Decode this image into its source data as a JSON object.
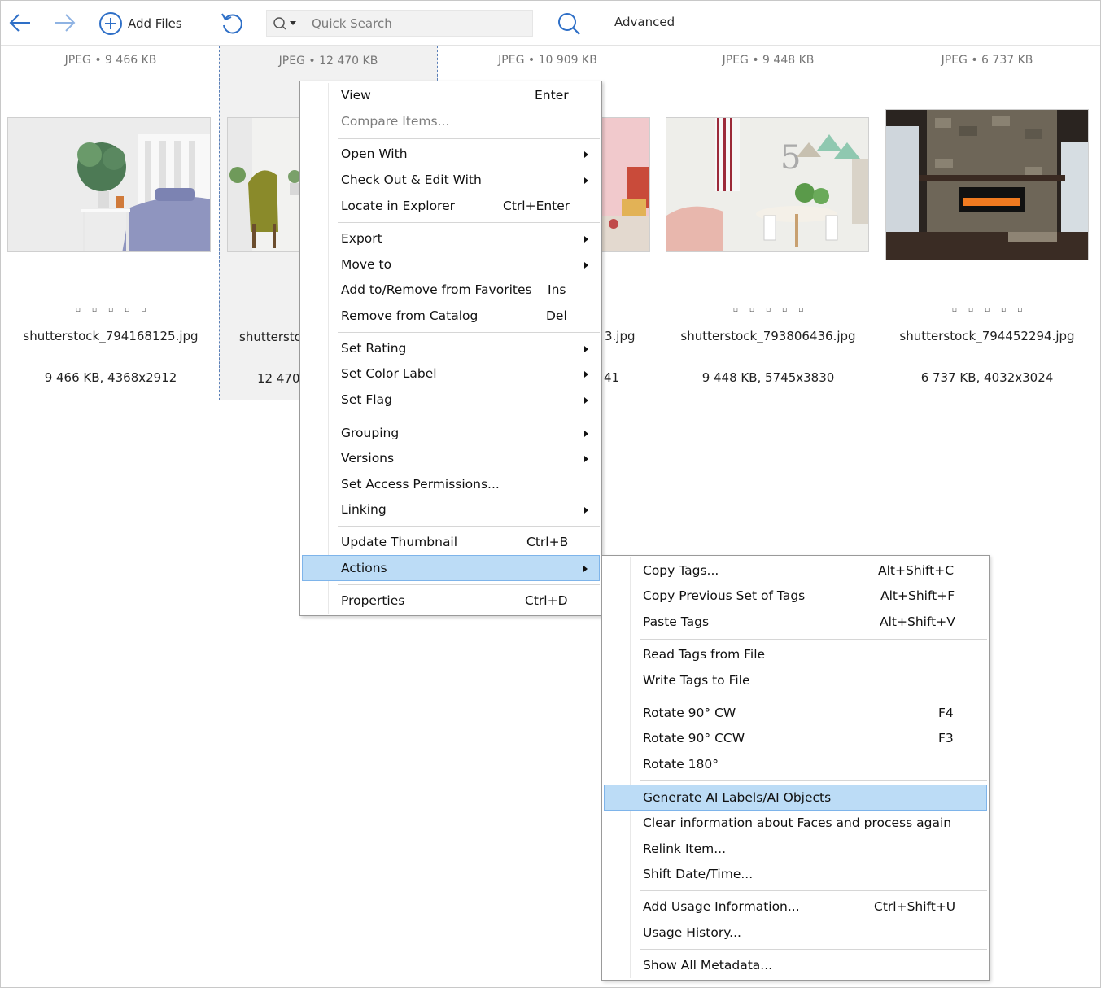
{
  "toolbar": {
    "add_files": "Add Files",
    "search_placeholder": "Quick Search",
    "advanced": "Advanced"
  },
  "tiles": [
    {
      "format": "JPEG • 9 466 KB",
      "filename": "shutterstock_794168125.jpg",
      "info": "9 466 KB, 4368x2912"
    },
    {
      "format": "JPEG • 12 470 KB",
      "filename": "shutterstock",
      "info": "12 470"
    },
    {
      "format": "JPEG • 10 909 KB",
      "filename": "3.jpg",
      "info": "41"
    },
    {
      "format": "JPEG • 9 448 KB",
      "filename": "shutterstock_793806436.jpg",
      "info": "9 448 KB, 5745x3830"
    },
    {
      "format": "JPEG • 6 737 KB",
      "filename": "shutterstock_794452294.jpg",
      "info": "6 737 KB, 4032x3024"
    }
  ],
  "context_menu": {
    "view": "View",
    "view_sc": "Enter",
    "compare": "Compare Items...",
    "open_with": "Open With",
    "checkout": "Check Out & Edit With",
    "locate": "Locate in Explorer",
    "locate_sc": "Ctrl+Enter",
    "export": "Export",
    "move_to": "Move to",
    "favorites": "Add to/Remove from Favorites",
    "favorites_sc": "Ins",
    "remove": "Remove from Catalog",
    "remove_sc": "Del",
    "set_rating": "Set Rating",
    "set_color": "Set Color Label",
    "set_flag": "Set Flag",
    "grouping": "Grouping",
    "versions": "Versions",
    "permissions": "Set Access Permissions...",
    "linking": "Linking",
    "update_thumb": "Update Thumbnail",
    "update_thumb_sc": "Ctrl+B",
    "actions": "Actions",
    "properties": "Properties",
    "properties_sc": "Ctrl+D"
  },
  "actions_menu": {
    "copy_tags": "Copy Tags...",
    "copy_tags_sc": "Alt+Shift+C",
    "copy_prev": "Copy Previous Set of Tags",
    "copy_prev_sc": "Alt+Shift+F",
    "paste_tags": "Paste Tags",
    "paste_tags_sc": "Alt+Shift+V",
    "read_tags": "Read Tags from File",
    "write_tags": "Write Tags to File",
    "rot_cw": "Rotate 90° CW",
    "rot_cw_sc": "F4",
    "rot_ccw": "Rotate 90° CCW",
    "rot_ccw_sc": "F3",
    "rot_180": "Rotate 180°",
    "gen_ai": "Generate AI Labels/AI Objects",
    "clear_faces": "Clear information about Faces and process again",
    "relink": "Relink Item...",
    "shift_date": "Shift Date/Time...",
    "add_usage": "Add Usage Information...",
    "add_usage_sc": "Ctrl+Shift+U",
    "usage_history": "Usage History...",
    "show_metadata": "Show All Metadata..."
  },
  "colors": {
    "highlight": "#bcdcf6",
    "accent_blue": "#2e6fc7"
  }
}
